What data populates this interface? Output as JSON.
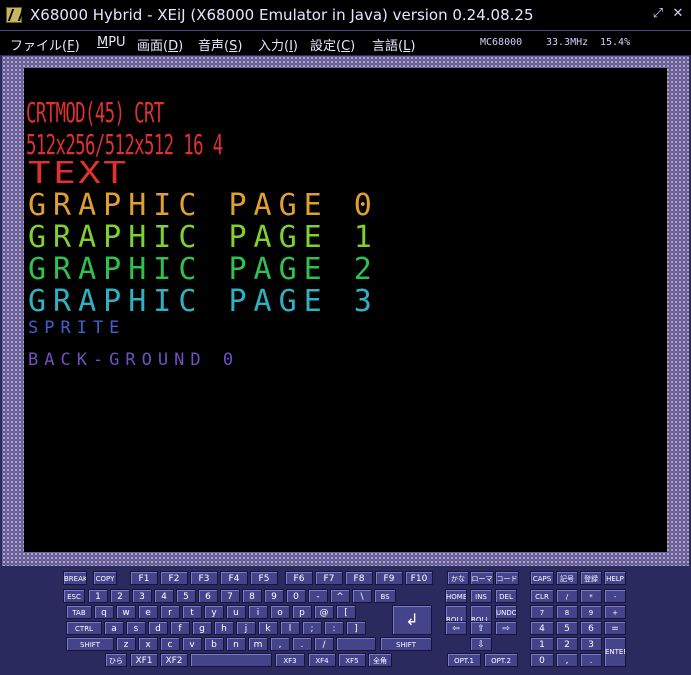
{
  "window": {
    "title": "X68000 Hybrid - XEiJ (X68000 Emulator in Java) version 0.24.08.25",
    "restore_icon": "restore-icon",
    "close_icon": "close-icon"
  },
  "menu": [
    {
      "label": "ファイル(",
      "key": "F",
      "suffix": ")"
    },
    {
      "label": "",
      "key": "M",
      "suffix": "PU"
    },
    {
      "label": "画面(",
      "key": "D",
      "suffix": ")"
    },
    {
      "label": "音声(",
      "key": "S",
      "suffix": ")"
    },
    {
      "label": "入力(",
      "key": "I",
      "suffix": ")"
    },
    {
      "label": "設定(",
      "key": "C",
      "suffix": ")"
    },
    {
      "label": "言語(",
      "key": "L",
      "suffix": ")"
    }
  ],
  "status": {
    "cpu": "MC68000",
    "clock": "33.3MHz",
    "load": "15.4%"
  },
  "screen": {
    "lines": [
      {
        "text": "CRTMOD(45) CRT",
        "color": "#e03030"
      },
      {
        "text": "512x256/512x512 16 4",
        "color": "#e03030"
      },
      {
        "text": "TEXT",
        "color": "#e03030"
      },
      {
        "text": "GRAPHIC PAGE 0",
        "color": "#e0a030"
      },
      {
        "text": "GRAPHIC PAGE 1",
        "color": "#80d030"
      },
      {
        "text": "GRAPHIC PAGE 2",
        "color": "#30c050"
      },
      {
        "text": "GRAPHIC PAGE 3",
        "color": "#30b0c0"
      },
      {
        "text": "SPRITE",
        "color": "#4060d0"
      },
      {
        "text": "BACK-GROUND 0",
        "color": "#7050c0"
      }
    ]
  },
  "keyboard": {
    "row_fn": [
      "BREAK",
      "COPY",
      "F1",
      "F2",
      "F3",
      "F4",
      "F5",
      "F6",
      "F7",
      "F8",
      "F9",
      "F10",
      "かな",
      "ローマ",
      "コード",
      "CAPS",
      "記号",
      "登録",
      "HELP"
    ],
    "row1": [
      "ESC",
      "1",
      "2",
      "3",
      "4",
      "5",
      "6",
      "7",
      "8",
      "9",
      "0",
      "-",
      "^",
      "\\",
      "BS",
      "HOME",
      "INS",
      "DEL",
      "CLR",
      "/",
      "*",
      "-"
    ],
    "row2": [
      "TAB",
      "q",
      "w",
      "e",
      "r",
      "t",
      "y",
      "u",
      "i",
      "o",
      "p",
      "@",
      "[",
      "ROLL UP",
      "ROLL DOWN",
      "UNDO",
      "7",
      "8",
      "9",
      "+"
    ],
    "row3": [
      "CTRL",
      "a",
      "s",
      "d",
      "f",
      "g",
      "h",
      "j",
      "k",
      "l",
      ";",
      ":",
      "]",
      "⇦",
      "⇧",
      "⇨",
      "4",
      "5",
      "6",
      "="
    ],
    "row4": [
      "SHIFT",
      "z",
      "x",
      "c",
      "v",
      "b",
      "n",
      "m",
      ",",
      ".",
      "/",
      "",
      "SHIFT",
      "⇩",
      "1",
      "2",
      "3",
      "ENTER"
    ],
    "row5": [
      "ひら",
      "XF1",
      "XF2",
      "",
      "XF3",
      "XF4",
      "XF5",
      "全角",
      "OPT.1",
      "OPT.2",
      "0",
      ",",
      "."
    ],
    "return_key": "↲"
  }
}
